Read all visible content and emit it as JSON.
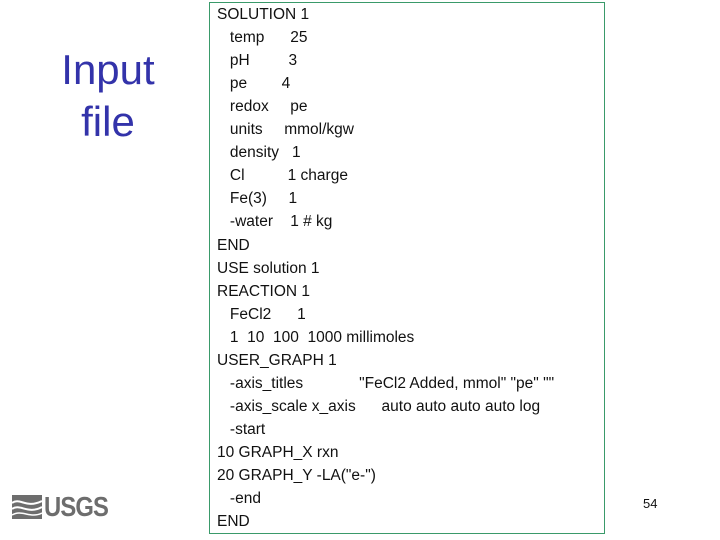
{
  "slide": {
    "title_lines": [
      "Input",
      "file"
    ],
    "page_number": "54",
    "logo_text": "USGS",
    "accent_color": "#3333aa",
    "box_border_color": "#3a9a6a"
  },
  "code_lines": [
    "SOLUTION 1",
    "   temp      25",
    "   pH         3",
    "   pe        4",
    "   redox     pe",
    "   units     mmol/kgw",
    "   density   1",
    "   Cl          1 charge",
    "   Fe(3)     1",
    "   -water    1 # kg",
    "END",
    "USE solution 1",
    "REACTION 1",
    "   FeCl2      1",
    "   1  10  100  1000 millimoles",
    "USER_GRAPH 1",
    "   -axis_titles             \"FeCl2 Added, mmol\" \"pe\" \"\"",
    "   -axis_scale x_axis      auto auto auto auto log",
    "   -start",
    "10 GRAPH_X rxn",
    "20 GRAPH_Y -LA(\"e-\")",
    "   -end",
    "END"
  ]
}
